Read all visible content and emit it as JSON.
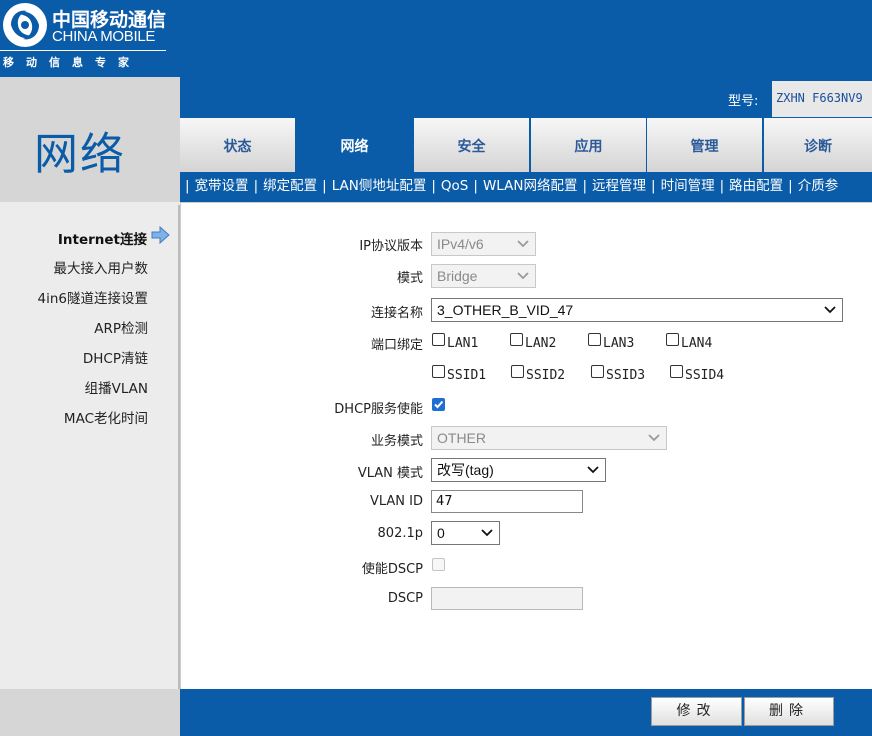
{
  "header": {
    "logo_cn": "中国移动通信",
    "logo_en": "CHINA MOBILE",
    "slogan": "移动信息专家",
    "model_label": "型号:",
    "model_value": "ZXHN F663NV9"
  },
  "section_title": "网络",
  "tabs": [
    {
      "label": "状态",
      "active": false
    },
    {
      "label": "网络",
      "active": true
    },
    {
      "label": "安全",
      "active": false
    },
    {
      "label": "应用",
      "active": false
    },
    {
      "label": "管理",
      "active": false
    },
    {
      "label": "诊断",
      "active": false
    }
  ],
  "subnav": {
    "sep": "|",
    "items": [
      "宽带设置",
      "绑定配置",
      "LAN侧地址配置",
      "QoS",
      "WLAN网络配置",
      "远程管理",
      "时间管理",
      "路由配置",
      "介质参"
    ]
  },
  "left_menu": [
    {
      "label": "Internet连接",
      "active": true
    },
    {
      "label": "最大接入用户数",
      "active": false
    },
    {
      "label": "4in6隧道连接设置",
      "active": false
    },
    {
      "label": "ARP检测",
      "active": false
    },
    {
      "label": "DHCP清链",
      "active": false
    },
    {
      "label": "组播VLAN",
      "active": false
    },
    {
      "label": "MAC老化时间",
      "active": false
    }
  ],
  "form": {
    "ip_version": {
      "label": "IP协议版本",
      "value": "IPv4/v6"
    },
    "mode": {
      "label": "模式",
      "value": "Bridge"
    },
    "conn_name": {
      "label": "连接名称",
      "value": "3_OTHER_B_VID_47"
    },
    "port_bind": {
      "label": "端口绑定",
      "lan": [
        "LAN1",
        "LAN2",
        "LAN3",
        "LAN4"
      ],
      "ssid": [
        "SSID1",
        "SSID2",
        "SSID3",
        "SSID4"
      ]
    },
    "dhcp_enable": {
      "label": "DHCP服务使能",
      "checked": true
    },
    "service_mode": {
      "label": "业务模式",
      "value": "OTHER"
    },
    "vlan_mode": {
      "label": "VLAN 模式",
      "value": "改写(tag)"
    },
    "vlan_id": {
      "label": "VLAN ID",
      "value": "47"
    },
    "dot1p": {
      "label": "802.1p",
      "value": "0"
    },
    "dscp_enable": {
      "label": "使能DSCP",
      "checked": false
    },
    "dscp": {
      "label": "DSCP",
      "value": ""
    }
  },
  "buttons": {
    "modify": "修改",
    "delete": "删除"
  },
  "colors": {
    "brand_blue": "#0a5ba8",
    "checkbox_blue": "#1f6ed4"
  }
}
